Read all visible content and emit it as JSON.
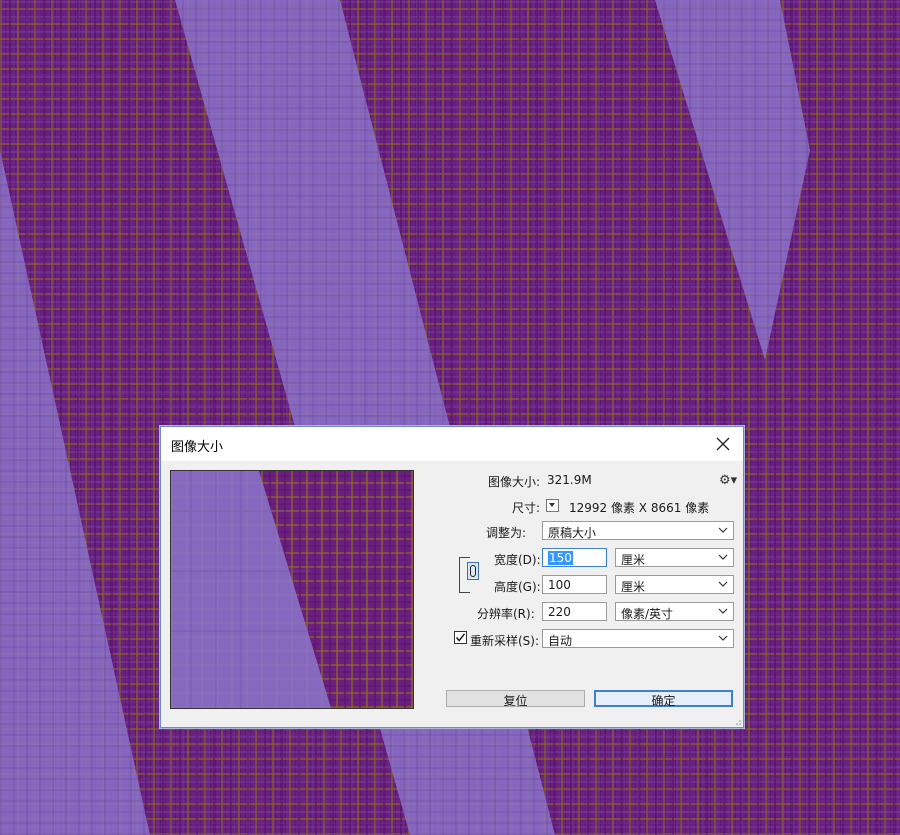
{
  "dialog": {
    "title": "图像大小",
    "image_size_label": "图像大小:",
    "image_size_value": "321.9M",
    "dimensions_label": "尺寸:",
    "dimensions_value": "12992 像素  X  8661 像素",
    "fit_to_label": "调整为:",
    "fit_to_value": "原稿大小",
    "width_label": "宽度(D):",
    "width_value": "150",
    "width_unit": "厘米",
    "height_label": "高度(G):",
    "height_value": "100",
    "height_unit": "厘米",
    "resolution_label": "分辨率(R):",
    "resolution_value": "220",
    "resolution_unit": "像素/英寸",
    "resample_label": "重新采样(S):",
    "resample_checked": true,
    "resample_value": "自动",
    "reset_button": "复位",
    "ok_button": "确定"
  },
  "colors": {
    "background_purple": "#6b1f7e",
    "band_lavender": "#8b73c9",
    "texture_gold": "#968010",
    "accent_blue": "#3c7fd4",
    "selection_blue": "#3399ff"
  },
  "icons": {
    "close": "close-icon",
    "gear": "gear-icon",
    "dimensions_menu": "chevron-down-icon",
    "link": "link-icon",
    "select_arrow": "chevron-down-icon",
    "checkbox": "checkmark-icon"
  }
}
